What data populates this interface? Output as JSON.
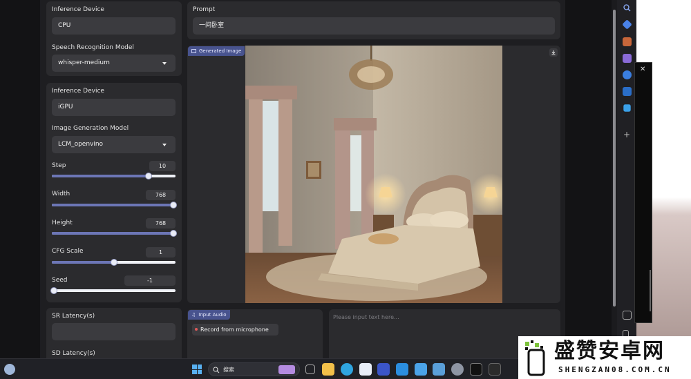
{
  "speech": {
    "device_label": "Inference Device",
    "device_value": "CPU",
    "model_label": "Speech Recognition Model",
    "model_value": "whisper-medium"
  },
  "image_gen": {
    "device_label": "Inference Device",
    "device_value": "iGPU",
    "model_label": "Image Generation Model",
    "model_value": "LCM_openvino",
    "step_label": "Step",
    "step_value": "10",
    "step_fill": 0.78,
    "width_label": "Width",
    "width_value": "768",
    "width_fill": 1.0,
    "height_label": "Height",
    "height_value": "768",
    "height_fill": 1.0,
    "cfg_label": "CFG Scale",
    "cfg_value": "1",
    "cfg_fill": 0.5,
    "seed_label": "Seed",
    "seed_value": "-1",
    "seed_fill": 0.0
  },
  "latency": {
    "sr_label": "SR Latency(s)",
    "sd_label": "SD Latency(s)"
  },
  "prompt": {
    "label": "Prompt",
    "value": "一间卧室"
  },
  "generated": {
    "tag": "Generated Image"
  },
  "audio": {
    "tag": "Input Audio",
    "record_label": "Record from microphone"
  },
  "text_input": {
    "placeholder": "Please input text here..."
  },
  "taskbar": {
    "search_label": "搜索"
  },
  "watermark": {
    "title": "盛赞安卓网",
    "url": "SHENGZAN08.COM.CN"
  },
  "colors": {
    "accent": "#6c76b6",
    "tag": "#48538e",
    "panel": "#2b2b2e",
    "field": "#3b3b3f"
  }
}
